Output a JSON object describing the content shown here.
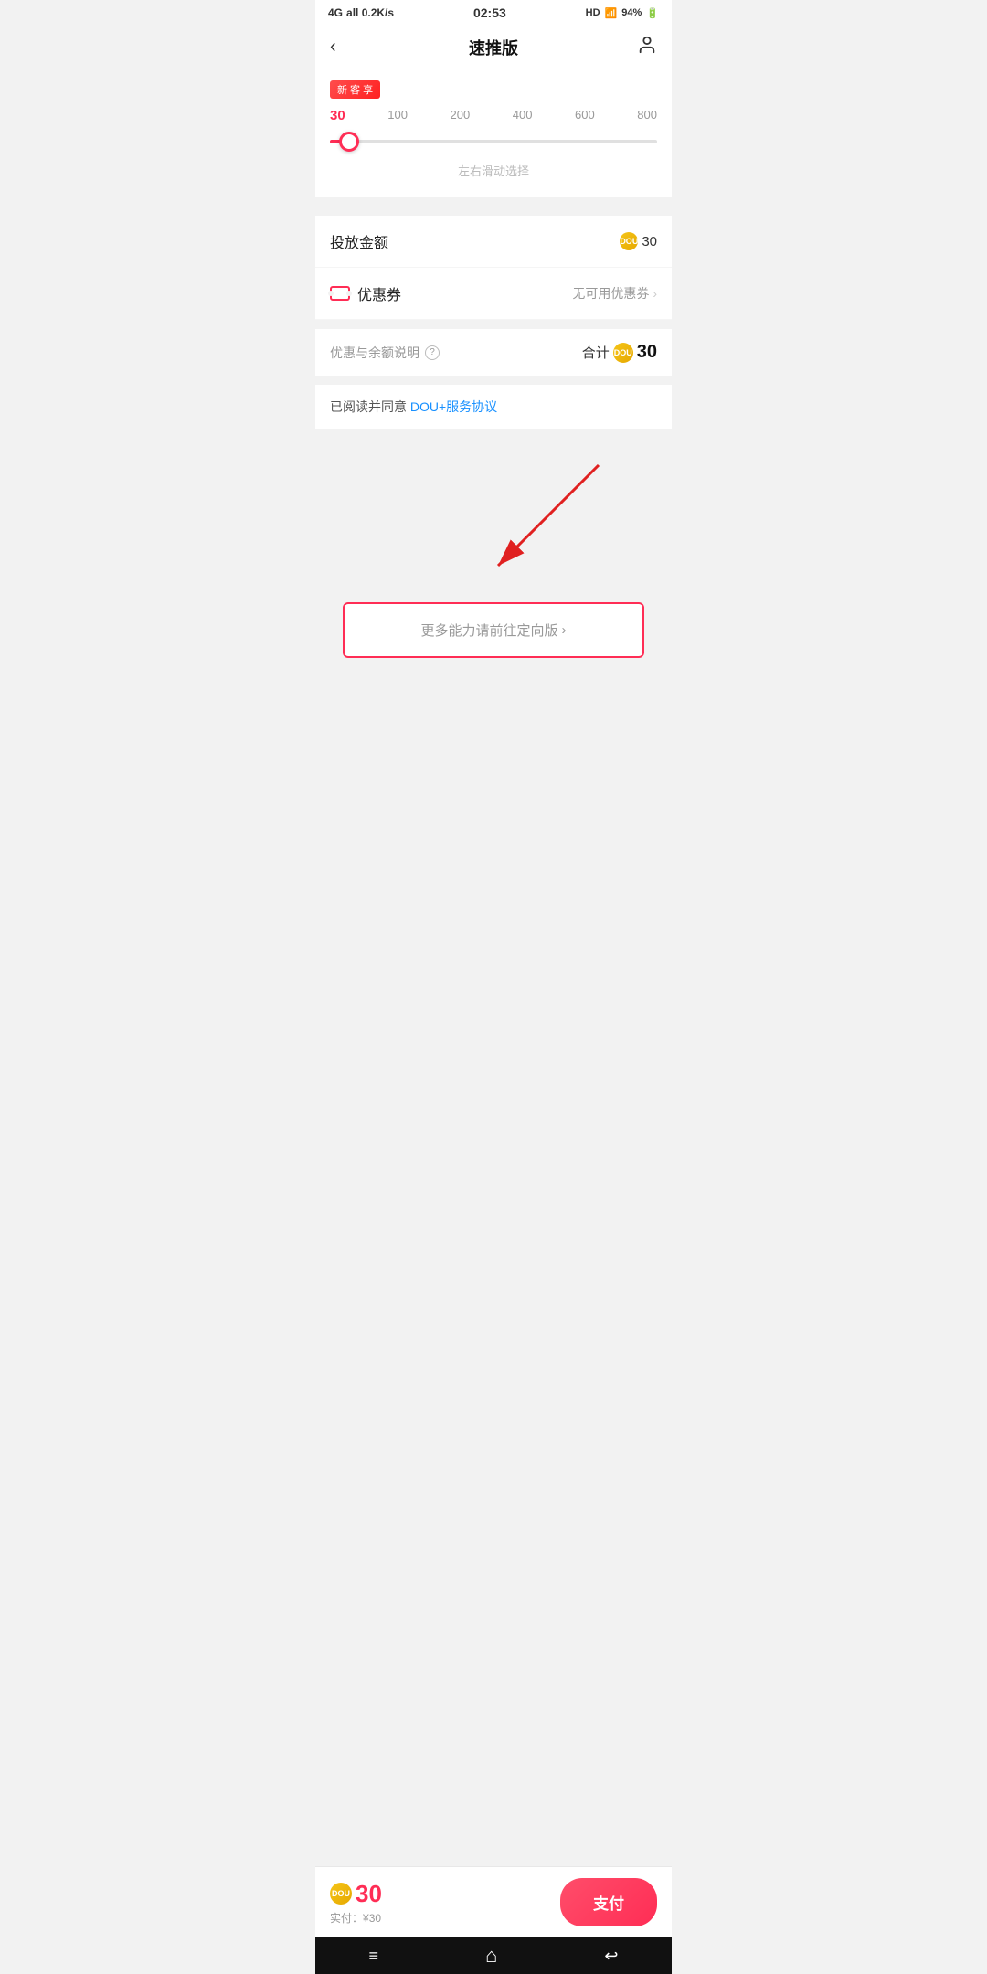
{
  "statusBar": {
    "network": "4G",
    "signal": "all 0.2K/s",
    "time": "02:53",
    "hd": "HD",
    "wifi": "94%",
    "battery": "94%"
  },
  "navBar": {
    "title": "速推版",
    "backLabel": "‹",
    "userIcon": "user"
  },
  "slider": {
    "promoBadge": "新 客 享",
    "values": [
      "30",
      "100",
      "200",
      "400",
      "600",
      "800"
    ],
    "hint": "左右滑动选择"
  },
  "investAmount": {
    "label": "投放金额",
    "value": "30"
  },
  "coupon": {
    "label": "优惠券",
    "value": "无可用优惠券"
  },
  "summary": {
    "label": "优惠与余额说明",
    "totalLabel": "合计",
    "totalValue": "30"
  },
  "agreement": {
    "prefixText": "已阅读并同意 ",
    "linkText": "DOU+服务协议"
  },
  "moreBtn": {
    "label": "更多能力请前往定向版",
    "chevron": "›"
  },
  "bottomBar": {
    "coinValue": "30",
    "actualPayLabel": "实付：",
    "actualPayValue": "¥30",
    "payBtnLabel": "支付"
  },
  "bottomNav": {
    "menuIcon": "≡",
    "homeIcon": "⌂",
    "backIcon": "↩"
  }
}
